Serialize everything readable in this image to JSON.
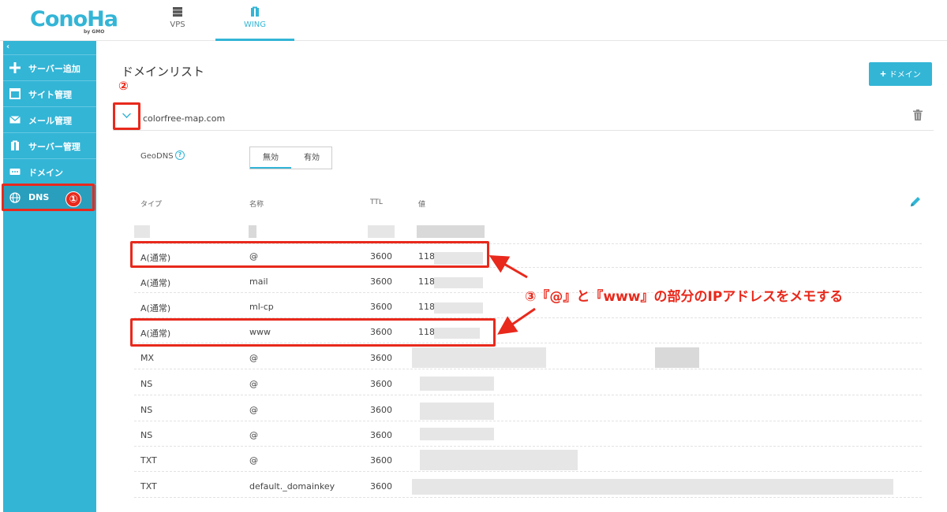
{
  "header": {
    "logo": "ConoHa",
    "logo_sub": "by GMO",
    "tabs": [
      {
        "label": "VPS",
        "icon": "server-icon",
        "active": false
      },
      {
        "label": "WING",
        "icon": "wing-icon",
        "active": true
      }
    ],
    "accent_color": "#33b5d6"
  },
  "sidebar": {
    "collapse": "‹",
    "items": [
      {
        "label": "サーバー追加",
        "icon": "plus-icon"
      },
      {
        "label": "サイト管理",
        "icon": "site-icon"
      },
      {
        "label": "メール管理",
        "icon": "mail-icon"
      },
      {
        "label": "サーバー管理",
        "icon": "server-manage-icon"
      },
      {
        "label": "ドメイン",
        "icon": "domain-icon"
      },
      {
        "label": "DNS",
        "icon": "globe-icon",
        "active": true
      }
    ]
  },
  "main": {
    "title": "ドメインリスト",
    "add_button": "ドメイン",
    "add_button_plus": "+",
    "domain": "colorfree-map.com",
    "geodns": {
      "label": "GeoDNS",
      "help": "?",
      "off": "無効",
      "on": "有効",
      "selected": "無効"
    },
    "columns": {
      "type": "タイプ",
      "name": "名称",
      "ttl": "TTL",
      "value": "値"
    },
    "records": [
      {
        "type": "",
        "name": "",
        "ttl": "",
        "value": ""
      },
      {
        "type": "A(通常)",
        "name": "@",
        "ttl": "3600",
        "value": "118"
      },
      {
        "type": "A(通常)",
        "name": "mail",
        "ttl": "3600",
        "value": "118"
      },
      {
        "type": "A(通常)",
        "name": "ml-cp",
        "ttl": "3600",
        "value": "118"
      },
      {
        "type": "A(通常)",
        "name": "www",
        "ttl": "3600",
        "value": "118"
      },
      {
        "type": "MX",
        "name": "@",
        "ttl": "3600",
        "value": ""
      },
      {
        "type": "NS",
        "name": "@",
        "ttl": "3600",
        "value": ""
      },
      {
        "type": "NS",
        "name": "@",
        "ttl": "3600",
        "value": ""
      },
      {
        "type": "NS",
        "name": "@",
        "ttl": "3600",
        "value": ""
      },
      {
        "type": "TXT",
        "name": "@",
        "ttl": "3600",
        "value": ""
      },
      {
        "type": "TXT",
        "name": "default._domainkey",
        "ttl": "3600",
        "value": ""
      }
    ]
  },
  "annotations": {
    "step1": "①",
    "step2": "②",
    "step3": "③『@』と『www』の部分のIPアドレスをメモする",
    "color": "#e8291c"
  }
}
